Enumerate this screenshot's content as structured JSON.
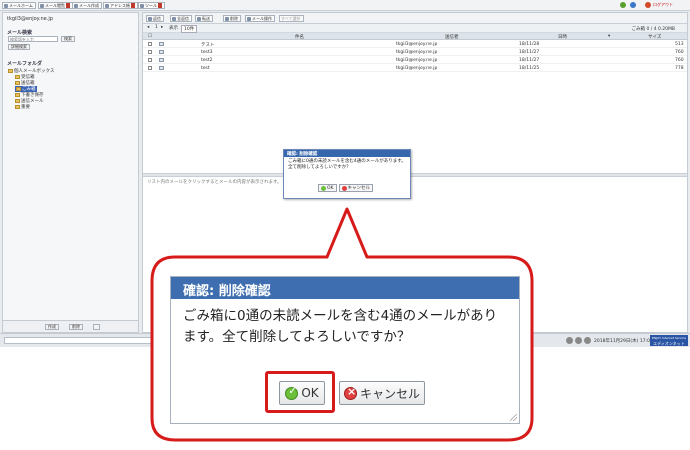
{
  "toolbar": {
    "items": [
      {
        "label": "メールホーム"
      },
      {
        "label": "メール閲覧"
      },
      {
        "label": "メール作成"
      },
      {
        "label": "アドレス帳"
      },
      {
        "label": "ツール"
      }
    ],
    "help": "?",
    "logout": "ログアウト"
  },
  "sidebar": {
    "user": "tkgil3@enjoy.ne.jp",
    "search_title": "メール検索",
    "search_placeholder": "検索語を入力",
    "search_button": "検索",
    "detail_search": "詳細検索",
    "folder_title": "メールフォルダ",
    "folders": [
      {
        "label": "個人メールボックス"
      },
      {
        "label": "受信箱"
      },
      {
        "label": "送信箱"
      },
      {
        "label": "ごみ箱"
      },
      {
        "label": "下書き保存"
      },
      {
        "label": "送信メール"
      },
      {
        "label": "重要"
      }
    ],
    "footer_buttons": [
      "作成",
      "削除"
    ]
  },
  "main": {
    "tool_buttons": [
      "返信",
      "全返信",
      "転送",
      "削除",
      "メール操作",
      "すべて選択"
    ],
    "folder_info": "ごみ箱 0 / 4 0.20MB",
    "display_label": "表示",
    "display_count": "10件",
    "columns": [
      "件名",
      "送信者",
      "日時",
      "サイズ"
    ],
    "rows": [
      {
        "subject": "テスト",
        "from": "tkgil3@enjoy.ne.jp",
        "date": "18/11/28",
        "size": "513"
      },
      {
        "subject": "test3",
        "from": "tkgil3@enjoy.ne.jp",
        "date": "18/11/27",
        "size": "760"
      },
      {
        "subject": "test2",
        "from": "tkgil3@enjoy.ne.jp",
        "date": "18/11/27",
        "size": "760"
      },
      {
        "subject": "test",
        "from": "tkgil3@enjoy.ne.jp",
        "date": "18/11/25",
        "size": "778"
      }
    ],
    "preview_hint": "リスト内のメールをクリックするとメールの内容が表示されます。"
  },
  "statusbar": {
    "clock": "2018年11月29日(木) 17:02",
    "brand_top": "ENJOY Internet Service",
    "brand": "エディオンネット"
  },
  "dialog_small": {
    "title": "確認: 削除確認",
    "message": "ごみ箱に0通の未読メールを含む4通のメールがあります。全て削除してよろしいですか？",
    "ok": "OK",
    "cancel": "キャンセル"
  },
  "dialog_zoom": {
    "title": "確認: 削除確認",
    "line1": "ごみ箱に0通の未読メールを含む4通のメールがあり",
    "line2": "ます。全て削除してよろしいですか？",
    "ok": "OK",
    "cancel": "キャンセル"
  },
  "colors": {
    "highlight": "#d71b1b",
    "title_bar": "#3e6eaf"
  }
}
